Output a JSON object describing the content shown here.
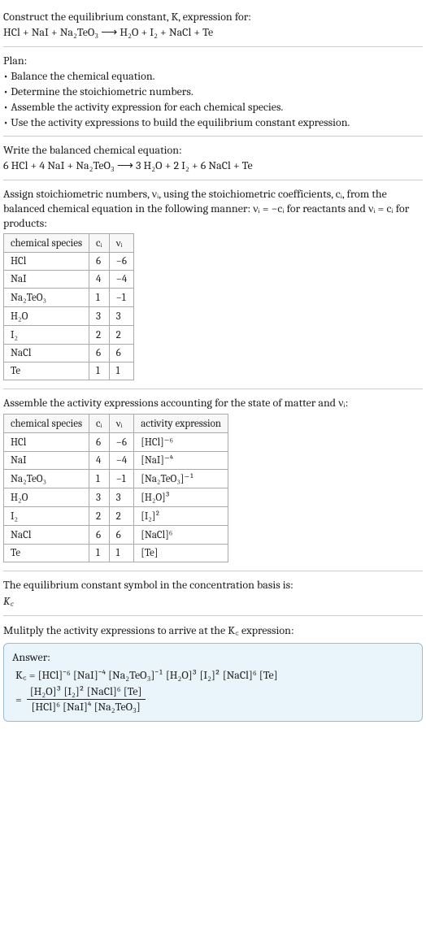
{
  "s1": {
    "l1": "Construct the equilibrium constant, K, expression for:",
    "l2": "HCl + NaI + Na₂TeO₃ ⟶ H₂O + I₂ + NaCl + Te"
  },
  "s2": {
    "title": "Plan:",
    "b1": "Balance the chemical equation.",
    "b2": "Determine the stoichiometric numbers.",
    "b3": "Assemble the activity expression for each chemical species.",
    "b4": "Use the activity expressions to build the equilibrium constant expression."
  },
  "s3": {
    "l1": "Write the balanced chemical equation:",
    "l2": "6 HCl + 4 NaI + Na₂TeO₃ ⟶ 3 H₂O + 2 I₂ + 6 NaCl + Te"
  },
  "s4": {
    "l1": "Assign stoichiometric numbers, νᵢ, using the stoichiometric coefficients, cᵢ, from the balanced chemical equation in the following manner: νᵢ = −cᵢ for reactants and νᵢ = cᵢ for products:",
    "h1": "chemical species",
    "h2": "cᵢ",
    "h3": "νᵢ",
    "r1s": "HCl",
    "r1c": "6",
    "r1v": "−6",
    "r2s": "NaI",
    "r2c": "4",
    "r2v": "−4",
    "r3s": "Na₂TeO₃",
    "r3c": "1",
    "r3v": "−1",
    "r4s": "H₂O",
    "r4c": "3",
    "r4v": "3",
    "r5s": "I₂",
    "r5c": "2",
    "r5v": "2",
    "r6s": "NaCl",
    "r6c": "6",
    "r6v": "6",
    "r7s": "Te",
    "r7c": "1",
    "r7v": "1"
  },
  "s5": {
    "l1": "Assemble the activity expressions accounting for the state of matter and νᵢ:",
    "h1": "chemical species",
    "h2": "cᵢ",
    "h3": "νᵢ",
    "h4": "activity expression",
    "r1s": "HCl",
    "r1c": "6",
    "r1v": "−6",
    "r1a": "[HCl]⁻⁶",
    "r2s": "NaI",
    "r2c": "4",
    "r2v": "−4",
    "r2a": "[NaI]⁻⁴",
    "r3s": "Na₂TeO₃",
    "r3c": "1",
    "r3v": "−1",
    "r3a": "[Na₂TeO₃]⁻¹",
    "r4s": "H₂O",
    "r4c": "3",
    "r4v": "3",
    "r4a": "[H₂O]³",
    "r5s": "I₂",
    "r5c": "2",
    "r5v": "2",
    "r5a": "[I₂]²",
    "r6s": "NaCl",
    "r6c": "6",
    "r6v": "6",
    "r6a": "[NaCl]⁶",
    "r7s": "Te",
    "r7c": "1",
    "r7v": "1",
    "r7a": "[Te]"
  },
  "s6": {
    "l1": "The equilibrium constant symbol in the concentration basis is:",
    "l2": "K꜀"
  },
  "s7": {
    "l1": "Mulitply the activity expressions to arrive at the K꜀ expression:"
  },
  "answer": {
    "title": "Answer:",
    "line1": "K꜀ = [HCl]⁻⁶ [NaI]⁻⁴ [Na₂TeO₃]⁻¹ [H₂O]³ [I₂]² [NaCl]⁶ [Te]",
    "num": "[H₂O]³ [I₂]² [NaCl]⁶ [Te]",
    "den": "[HCl]⁶ [NaI]⁴ [Na₂TeO₃]"
  }
}
